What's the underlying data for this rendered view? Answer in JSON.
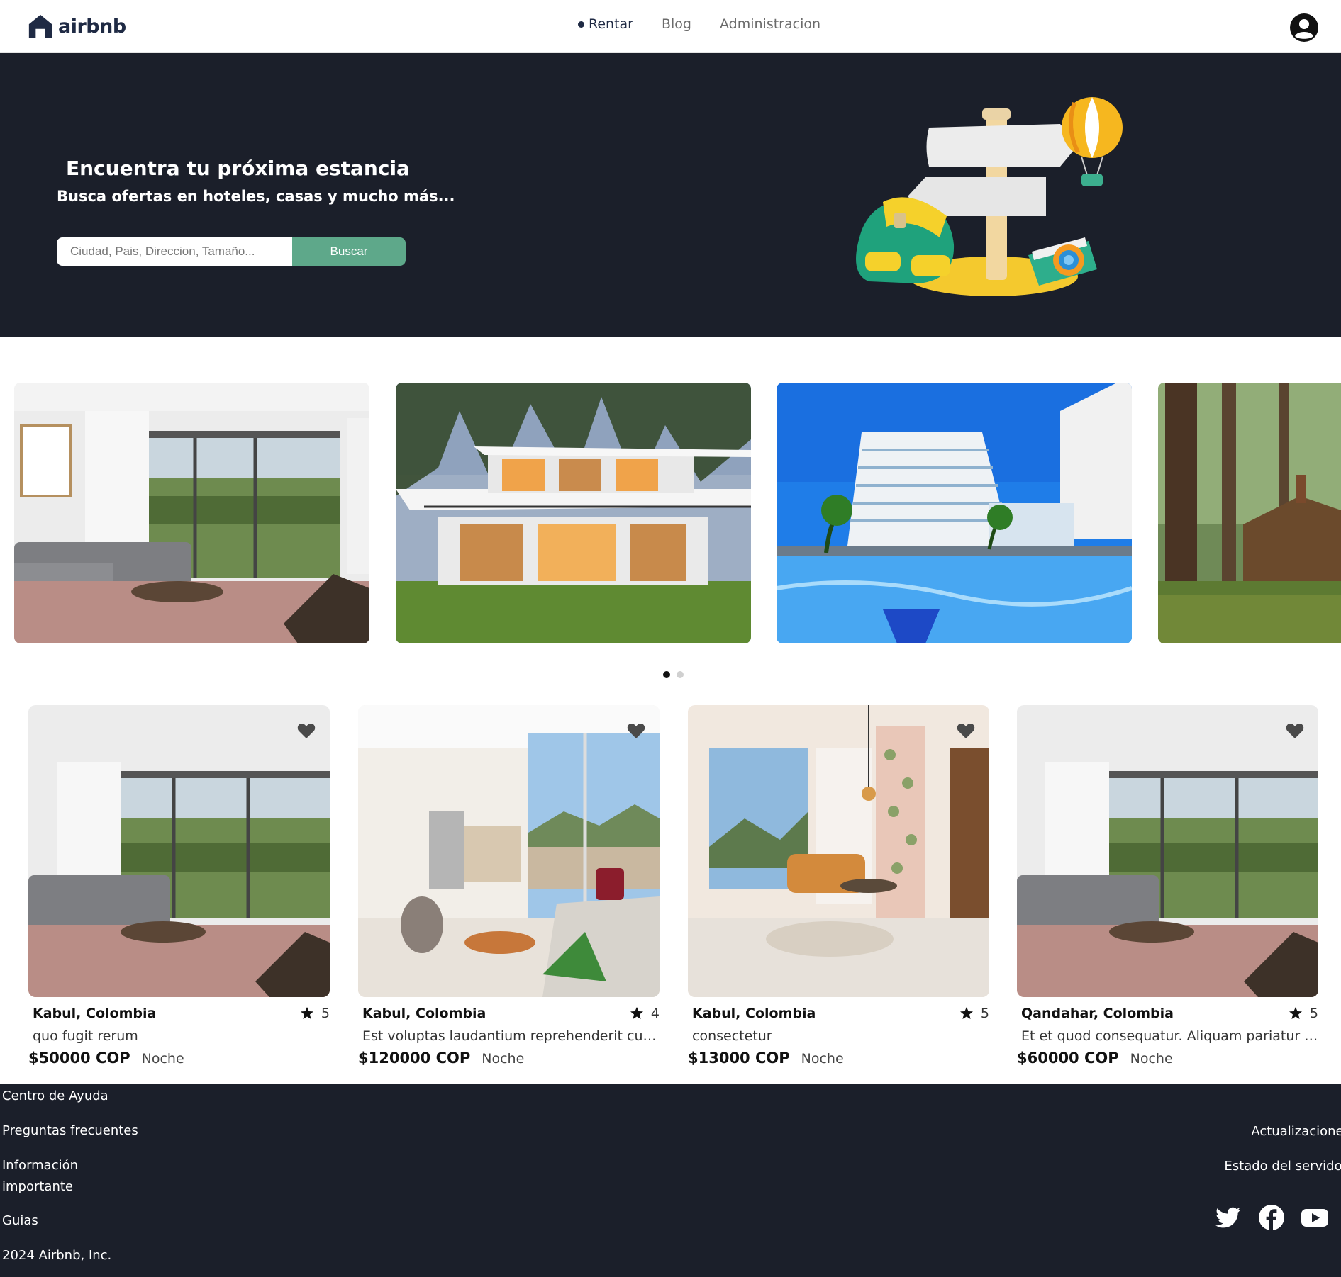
{
  "brand": {
    "name": "airbnb",
    "color": "#1f2a44"
  },
  "nav": {
    "links": [
      {
        "label": "Rentar",
        "active": true
      },
      {
        "label": "Blog",
        "active": false
      },
      {
        "label": "Administracion",
        "active": false
      }
    ],
    "user_icon": "user-circle-icon"
  },
  "hero": {
    "title": "Encuentra tu próxima estancia",
    "subtitle": "Busca ofertas en hoteles, casas y mucho más...",
    "search_placeholder": "Ciudad, Pais, Direccion, Tamaño...",
    "search_value": "",
    "search_button": "Buscar",
    "background": "#1b1f2a",
    "button_color": "#5ea88a"
  },
  "carousel": {
    "slides": [
      "living-room-photo",
      "modern-house-photo",
      "hotel-pool-photo",
      "forest-cabin-photo"
    ],
    "pages": 2,
    "active_page": 0
  },
  "listings": [
    {
      "location": "Kabul, Colombia",
      "rating": "5",
      "description": "quo fugit rerum",
      "price": "$50000 COP",
      "unit": "Noche"
    },
    {
      "location": "Kabul, Colombia",
      "rating": "4",
      "description": "Est voluptas laudantium reprehenderit culpa ...",
      "price": "$120000 COP",
      "unit": "Noche"
    },
    {
      "location": "Kabul, Colombia",
      "rating": "5",
      "description": "consectetur",
      "price": "$13000 COP",
      "unit": "Noche"
    },
    {
      "location": "Qandahar, Colombia",
      "rating": "5",
      "description": "Et et quod consequatur. Aliquam pariatur faci...",
      "price": "$60000 COP",
      "unit": "Noche"
    }
  ],
  "footer": {
    "links": [
      "Centro de Ayuda",
      "Preguntas frecuentes",
      "Información importante",
      "Guias"
    ],
    "copyright": "2024 Airbnb, Inc.",
    "right_links": [
      "Actualizaciones",
      "Estado del servidor"
    ],
    "social": [
      "twitter-icon",
      "facebook-icon",
      "youtube-icon"
    ]
  }
}
